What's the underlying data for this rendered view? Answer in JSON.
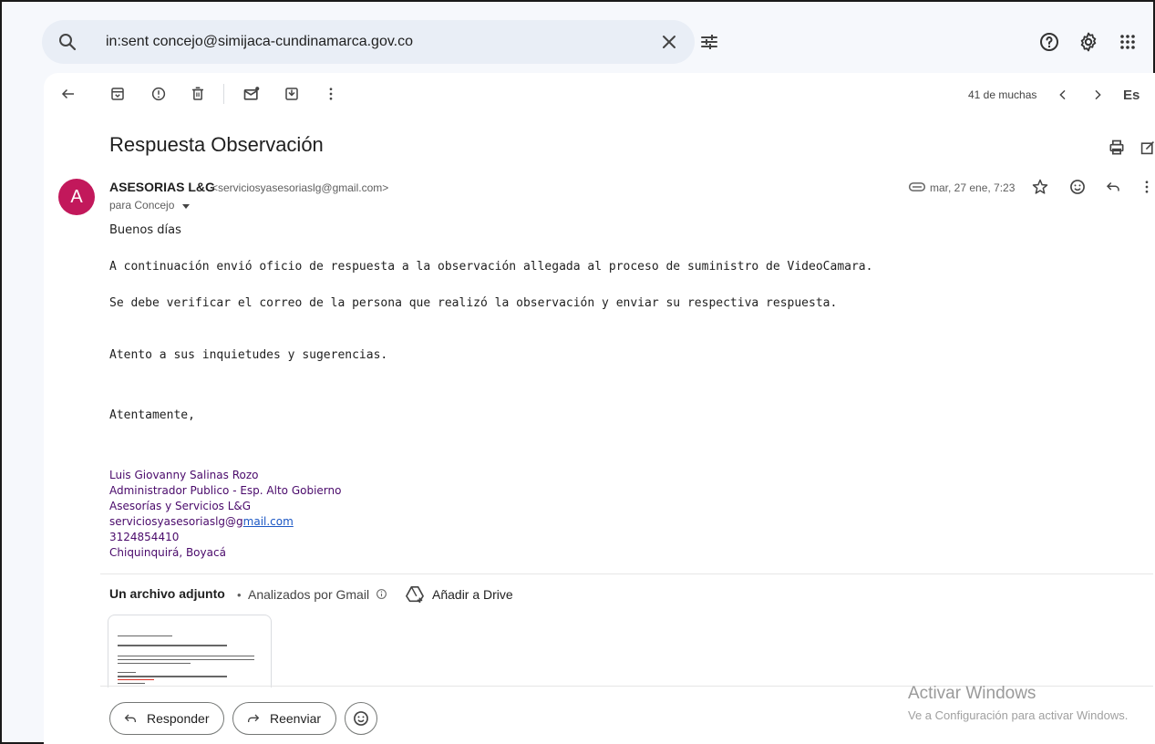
{
  "search": {
    "value": "in:sent concejo@simijaca-cundinamarca.gov.co"
  },
  "toolbar": {
    "count": "41 de muchas",
    "lang": "Es"
  },
  "message": {
    "subject": "Respuesta Observación",
    "avatar_letter": "A",
    "sender_name": "ASESORIAS L&G",
    "sender_email": "<serviciosyasesoriaslg@gmail.com>",
    "to": "para Concejo",
    "date": "mar, 27 ene, 7:23",
    "body": [
      "Buenos días",
      "A continuación envió oficio de respuesta a la observación allegada al proceso de suministro de VideoCamara.",
      "Se debe verificar el correo de la persona que realizó la observación y enviar su respectiva respuesta.",
      "Atento a sus inquietudes y sugerencias.",
      "Atentamente,"
    ],
    "signature": {
      "name": "Luis Giovanny Salinas Rozo",
      "title": "Administrador Publico - Esp. Alto Gobierno",
      "company": "Asesorías y Servicios L&G",
      "email_prefix": "serviciosyasesoriaslg@g",
      "email_link": "mail.com",
      "phone": "3124854410",
      "city": "Chiquinquirá, Boyacá"
    }
  },
  "attachments": {
    "title": "Un archivo adjunto",
    "dot": "•",
    "scanned": "Analizados por Gmail",
    "drive": "Añadir a Drive"
  },
  "actions": {
    "reply": "Responder",
    "forward": "Reenviar"
  },
  "watermark": {
    "title": "Activar Windows",
    "subtitle": "Ve a Configuración para activar Windows."
  },
  "colors": {
    "avatar": "#c2185b",
    "signature": "#4a0a6b",
    "link": "#1a56c4"
  }
}
